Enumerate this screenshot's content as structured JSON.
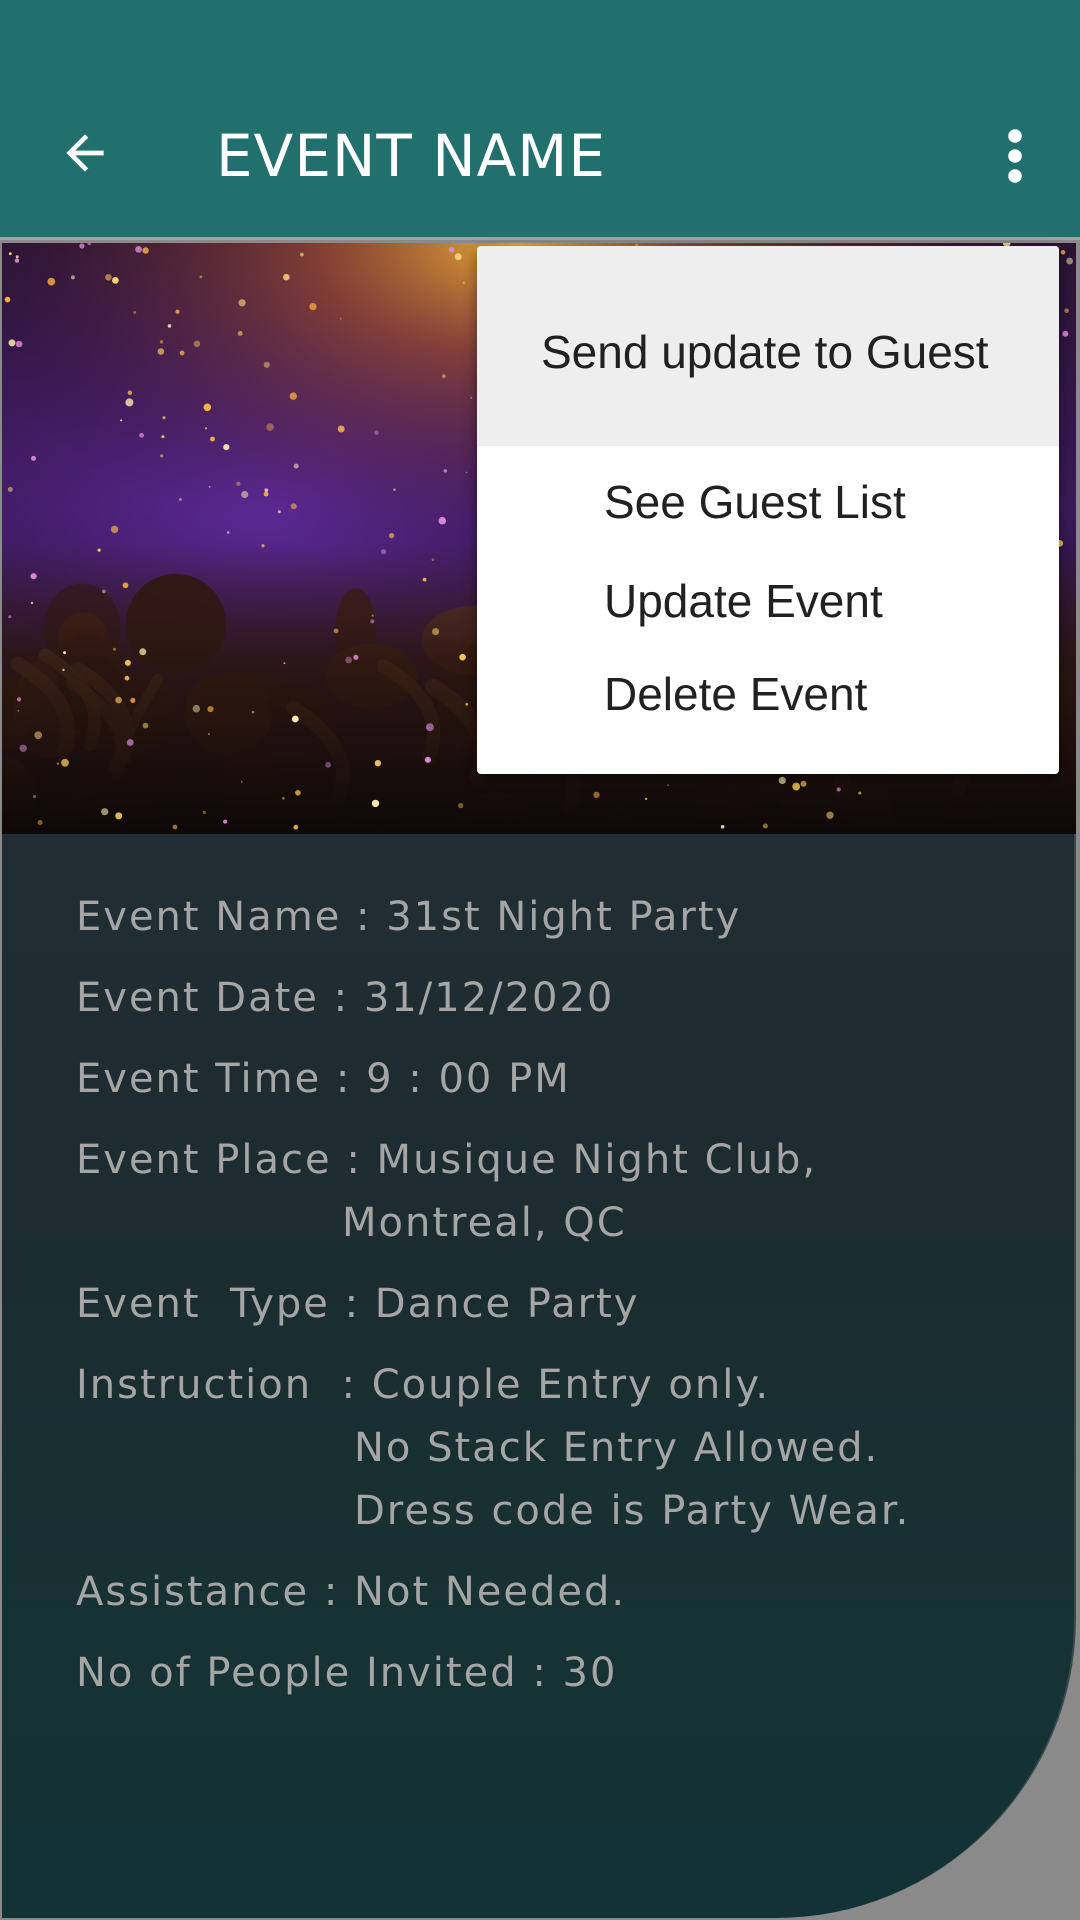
{
  "appbar": {
    "title": "EVENT NAME",
    "back_icon": "arrow-left-icon",
    "overflow_icon": "more-vertical-icon",
    "background_color": "#21706e"
  },
  "menu": {
    "items": [
      {
        "label": "Send update to Guest",
        "highlighted": true
      },
      {
        "label": "See Guest List"
      },
      {
        "label": "Update Event"
      },
      {
        "label": "Delete Event"
      }
    ]
  },
  "details": {
    "lines": [
      "Event Name : 31st Night Party",
      "Event Date : 31/12/2020",
      "Event Time : 9 : 00 PM",
      "Event Place : Musique Night Club,",
      "Montreal, QC",
      "Event  Type : Dance Party",
      "Instruction  : Couple Entry only.",
      "No Stack Entry Allowed.",
      "Dress code is Party Wear.",
      "Assistance : Not Needed.",
      "No of People Invited : 30"
    ]
  },
  "colors": {
    "details_background": "#1c2d31",
    "details_text": "#a5a5a5",
    "menu_highlight": "#eeeeee"
  }
}
